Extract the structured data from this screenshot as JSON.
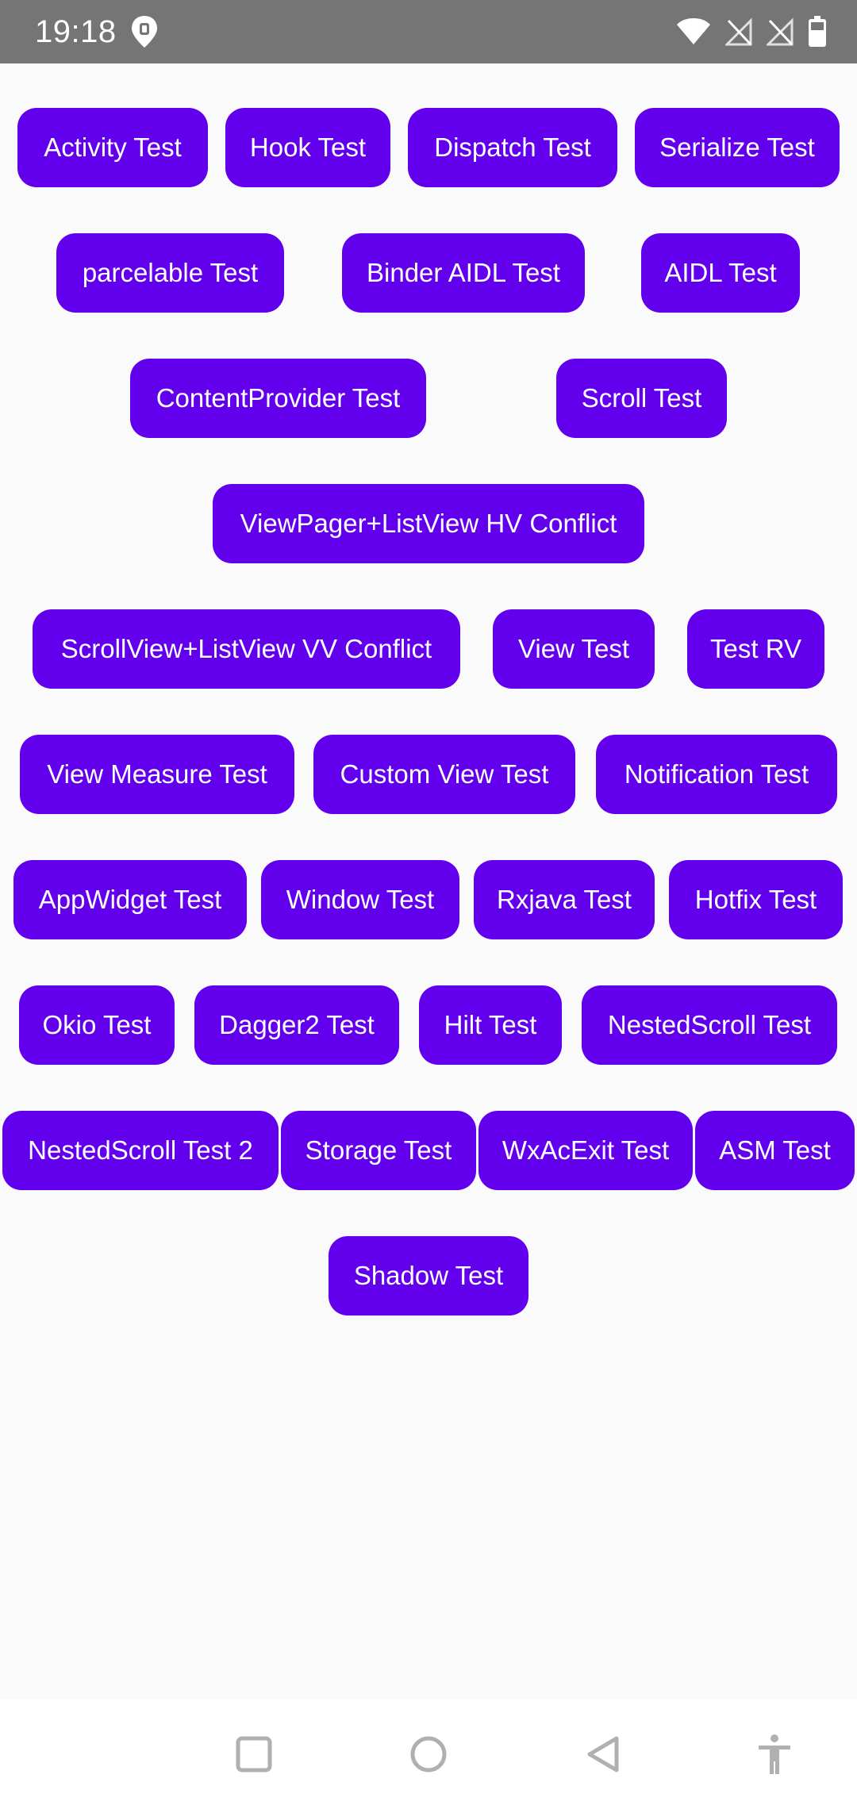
{
  "status_bar": {
    "time": "19:18",
    "icons": [
      "location-pin-icon",
      "wifi-icon",
      "no-sim-icon",
      "no-sim-icon",
      "battery-icon"
    ]
  },
  "colors": {
    "button_background": "#6200ee",
    "button_text": "#ffffff",
    "page_background": "#fafafa",
    "status_bar_background": "#757575"
  },
  "buttons": [
    {
      "label": "Activity Test"
    },
    {
      "label": "Hook Test"
    },
    {
      "label": "Dispatch Test"
    },
    {
      "label": "Serialize Test"
    },
    {
      "label": "parcelable Test"
    },
    {
      "label": "Binder AIDL Test"
    },
    {
      "label": "AIDL Test"
    },
    {
      "label": "ContentProvider Test"
    },
    {
      "label": "Scroll Test"
    },
    {
      "label": "ViewPager+ListView HV Conflict"
    },
    {
      "label": "ScrollView+ListView VV Conflict"
    },
    {
      "label": "View Test"
    },
    {
      "label": "Test RV"
    },
    {
      "label": "View Measure Test"
    },
    {
      "label": "Custom View Test"
    },
    {
      "label": "Notification Test"
    },
    {
      "label": "AppWidget Test"
    },
    {
      "label": "Window Test"
    },
    {
      "label": "Rxjava Test"
    },
    {
      "label": "Hotfix Test"
    },
    {
      "label": "Okio Test"
    },
    {
      "label": "Dagger2 Test"
    },
    {
      "label": "Hilt Test"
    },
    {
      "label": "NestedScroll Test"
    },
    {
      "label": "NestedScroll Test 2"
    },
    {
      "label": "Storage Test"
    },
    {
      "label": "WxAcExit Test"
    },
    {
      "label": "ASM Test"
    },
    {
      "label": "Shadow Test"
    }
  ],
  "nav_bar": {
    "icons": [
      "recents-square-icon",
      "home-circle-icon",
      "back-triangle-icon",
      "accessibility-icon"
    ]
  }
}
